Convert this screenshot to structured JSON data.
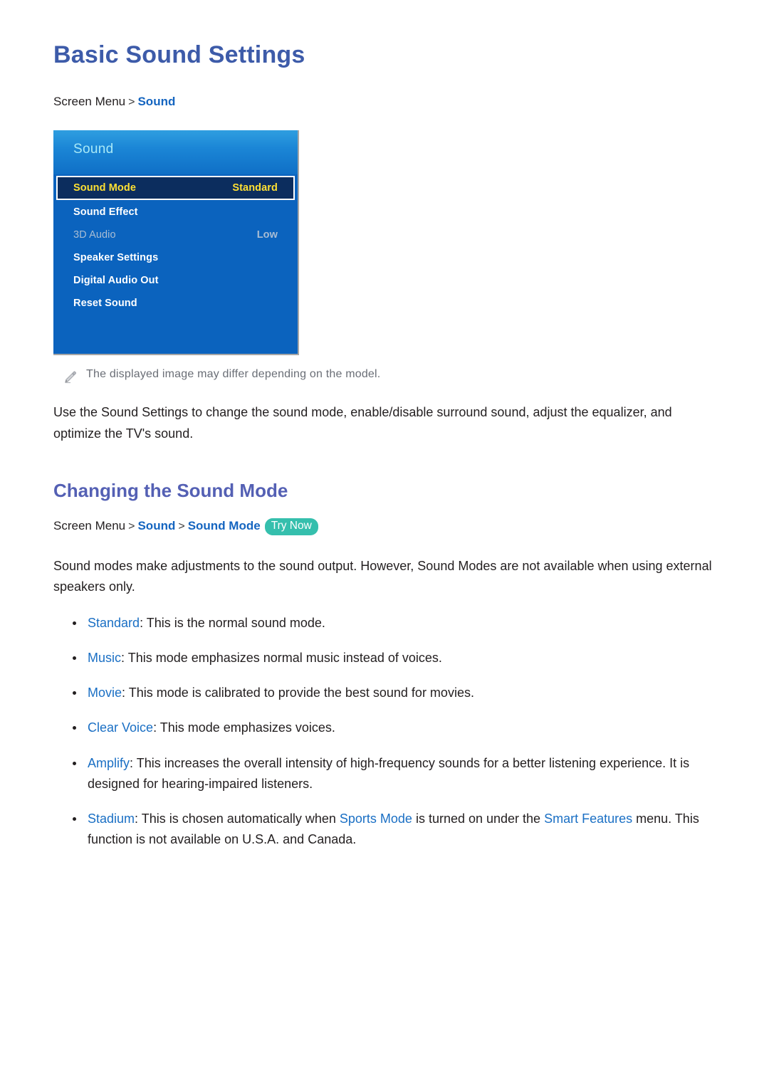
{
  "page": {
    "title": "Basic Sound Settings",
    "breadcrumb_top": {
      "root": "Screen Menu",
      "separator": ">",
      "link": "Sound"
    }
  },
  "tv_menu": {
    "header_title": "Sound",
    "selected_row": {
      "label": "Sound Mode",
      "value": "Standard"
    },
    "rows": [
      {
        "label": "Sound Effect",
        "value": "",
        "dimmed": false
      },
      {
        "label": "3D Audio",
        "value": "Low",
        "dimmed": true
      },
      {
        "label": "Speaker Settings",
        "value": "",
        "dimmed": false
      },
      {
        "label": "Digital Audio Out",
        "value": "",
        "dimmed": false
      },
      {
        "label": "Reset Sound",
        "value": "",
        "dimmed": false
      }
    ],
    "colors": {
      "panel_blue": "#0b63be",
      "header_top": "#2f9ee0",
      "selected_fill": "#0c2d5e",
      "selected_glow": "#2ad2ff",
      "selected_text": "#ffe033",
      "header_text": "#a8e9f7",
      "dim_text": "#a9bdd4"
    }
  },
  "note": {
    "icon": "pencil-icon",
    "text": "The displayed image may differ depending on the model."
  },
  "intro_paragraph": "Use the Sound Settings to change the sound mode, enable/disable surround sound, adjust the equalizer, and optimize the TV's sound.",
  "section": {
    "title": "Changing the Sound Mode",
    "breadcrumb": {
      "root": "Screen Menu",
      "separator": ">",
      "link1": "Sound",
      "link2": "Sound Mode",
      "badge": "Try Now",
      "badge_color": "#35bfad"
    },
    "lead_paragraph": "Sound modes make adjustments to the sound output. However, Sound Modes are not available when using external speakers only.",
    "bullets": [
      {
        "term": "Standard",
        "colon": ":",
        "text": " This is the normal sound mode."
      },
      {
        "term": "Music",
        "colon": ":",
        "text": " This mode emphasizes normal music instead of voices."
      },
      {
        "term": "Movie",
        "colon": ":",
        "text": " This mode is calibrated to provide the best sound for movies."
      },
      {
        "term": "Clear Voice",
        "colon": ":",
        "text": " This mode emphasizes voices."
      },
      {
        "term": "Amplify",
        "colon": ":",
        "text": " This increases the overall intensity of high-frequency sounds for a better listening experience. It is designed for hearing-impaired listeners."
      },
      {
        "term": "Stadium",
        "colon": ":",
        "text_part1": " This is chosen automatically when ",
        "link1": "Sports Mode",
        "text_part2": " is turned on under the ",
        "link2": "Smart Features",
        "text_part3": " menu. This function is not available on U.S.A. and Canada."
      }
    ]
  },
  "theme": {
    "title_color": "#3d5ba9",
    "section_title_color": "#5460b4",
    "link_color": "#1a6fc4",
    "body_color": "#231f20",
    "note_color": "#6a6e76"
  }
}
